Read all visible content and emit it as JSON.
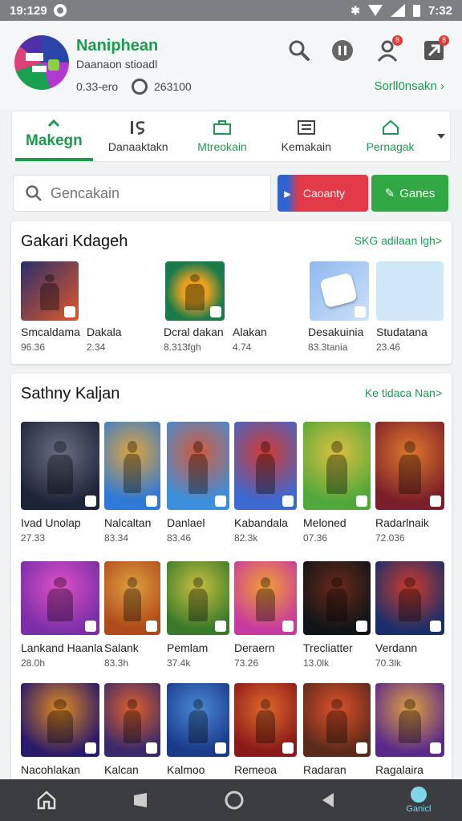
{
  "status_bar": {
    "time_left": "19:129",
    "time_right": "7:32"
  },
  "app": {
    "name": "Naniphean",
    "subtitle": "Daanaon stioadl",
    "size": "0.33-ero",
    "downloads": "263100",
    "promo_link": "Sorll0nsakn"
  },
  "header_icons": {
    "notif_badge_1": "8",
    "notif_badge_2": "8"
  },
  "tabs": [
    {
      "label": "Makegn",
      "icon": "chevron-up-icon",
      "active": true
    },
    {
      "label": "Danaaktakn",
      "icon": "is-icon"
    },
    {
      "label": "Mtreokain",
      "icon": "briefcase-icon"
    },
    {
      "label": "Kemakain",
      "icon": "list-icon"
    },
    {
      "label": "Pernagak",
      "icon": "home-icon"
    }
  ],
  "search": {
    "placeholder": "Gencakain"
  },
  "buttons": {
    "category": "Caoanty",
    "games": "Ganes"
  },
  "section1": {
    "title": "Gakari Kdageh",
    "link": "SKG adilaan lgh>",
    "items": [
      {
        "name": "Smcaldama",
        "meta": "96.36",
        "colors": [
          "#2b2f6a",
          "#e0582a"
        ]
      },
      {
        "name": "Dakala",
        "meta": "2.34"
      },
      {
        "name": "Dcral dakan",
        "meta": "8.313fgh",
        "colors": [
          "#1a7a4a",
          "#e8a020"
        ]
      },
      {
        "name": "Alakan",
        "meta": "4.74"
      },
      {
        "name": "Desakuinia",
        "meta": "83.3tania",
        "colors": [
          "#8fb9ee",
          "#cde0f8"
        ]
      },
      {
        "name": "Studatana",
        "meta": "23.46",
        "colors": [
          "#cfe7f6",
          "#cfe7f6"
        ]
      }
    ]
  },
  "section2": {
    "title": "Sathny Kaljan",
    "link": "Ke tidaca Nan>",
    "rows": [
      [
        {
          "name": "Ivad Unolap",
          "meta": "27.33",
          "colors": [
            "#1e2438",
            "#6a6f82"
          ]
        },
        {
          "name": "Nalcaltan",
          "meta": "83.34",
          "colors": [
            "#2f7ad8",
            "#e0a43a"
          ]
        },
        {
          "name": "Danlael",
          "meta": "83.46",
          "colors": [
            "#3b8fdc",
            "#d65a38"
          ]
        },
        {
          "name": "Kabandala",
          "meta": "82.3k",
          "colors": [
            "#3b6ad0",
            "#d63a30"
          ]
        },
        {
          "name": "Meloned",
          "meta": "07.36",
          "colors": [
            "#4ea83a",
            "#e0c040"
          ]
        },
        {
          "name": "Radarlnaik",
          "meta": "72.036",
          "colors": [
            "#7a1f2a",
            "#e0782a"
          ]
        }
      ],
      [
        {
          "name": "Lankand Haanla",
          "meta": "28.0h",
          "colors": [
            "#7a2fa8",
            "#e050c8"
          ]
        },
        {
          "name": "Salank",
          "meta": "83.3h",
          "colors": [
            "#b04a1a",
            "#e0a040"
          ]
        },
        {
          "name": "Pemlam",
          "meta": "37.4k",
          "colors": [
            "#3a7a2a",
            "#c8c040"
          ]
        },
        {
          "name": "Deraern",
          "meta": "73.26",
          "colors": [
            "#c83aa0",
            "#f0a030"
          ]
        },
        {
          "name": "Trecliatter",
          "meta": "13.0lk",
          "colors": [
            "#101418",
            "#6a2a1a"
          ]
        },
        {
          "name": "Verdann",
          "meta": "70.3lk",
          "colors": [
            "#1a2f6a",
            "#d03a2a"
          ]
        }
      ],
      [
        {
          "name": "Nacohlakan",
          "meta": "",
          "colors": [
            "#2a1a6a",
            "#e08a20"
          ]
        },
        {
          "name": "Kalcan",
          "meta": "",
          "colors": [
            "#3a2a6a",
            "#e0602a"
          ]
        },
        {
          "name": "Kalmoo",
          "meta": "",
          "colors": [
            "#1a3a8a",
            "#4a8ad8"
          ]
        },
        {
          "name": "Remeoa",
          "meta": "",
          "colors": [
            "#8a1a1a",
            "#e0682a"
          ]
        },
        {
          "name": "Radaran",
          "meta": "",
          "colors": [
            "#5a2a1a",
            "#e0502a"
          ]
        },
        {
          "name": "Ragalaira",
          "meta": "",
          "colors": [
            "#5a2a8a",
            "#e0a040"
          ]
        }
      ]
    ]
  },
  "nav": {
    "right_label": "Ganicl"
  },
  "colors": {
    "accent": "#1d9a50",
    "red": "#e23a48",
    "green_btn": "#31a843"
  }
}
